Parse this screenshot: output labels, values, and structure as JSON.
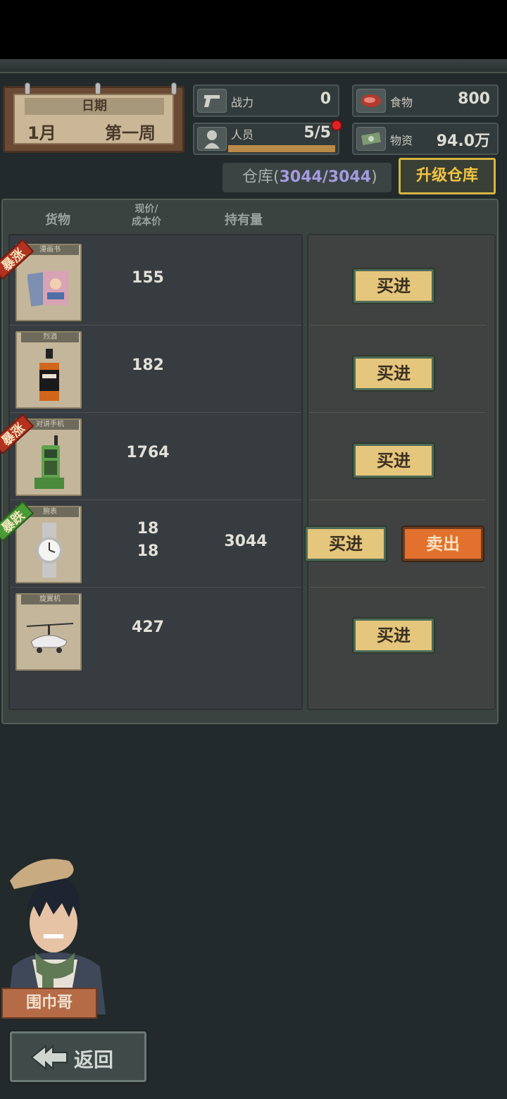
{
  "date": {
    "title": "日期",
    "month": "1月",
    "week": "第一周"
  },
  "stats": {
    "power": {
      "label": "战力",
      "value": "0",
      "icon": "pistol-icon"
    },
    "food": {
      "label": "食物",
      "value": "800",
      "icon": "steak-icon"
    },
    "staff": {
      "label": "人员",
      "value": "5/5",
      "icon": "person-icon",
      "progress": 1.0
    },
    "supplies": {
      "label": "物资",
      "value": "94.0万",
      "icon": "cash-icon"
    }
  },
  "warehouse": {
    "label": "仓库",
    "capacity": "3044/3044",
    "upgrade_label": "升级仓库"
  },
  "columns": {
    "goods": "货物",
    "price_line1": "现价/",
    "price_line2": "成本价",
    "holding": "持有量"
  },
  "items": [
    {
      "tag": "漫画书",
      "badge": "暴涨",
      "badge_type": "up",
      "price": "155",
      "cost": "",
      "holding": "",
      "buy": "买进",
      "sell": "",
      "icon": "comic-book-icon"
    },
    {
      "tag": "烈酒",
      "badge": "",
      "badge_type": "",
      "price": "182",
      "cost": "",
      "holding": "",
      "buy": "买进",
      "sell": "",
      "icon": "whiskey-bottle-icon"
    },
    {
      "tag": "对讲手机",
      "badge": "暴涨",
      "badge_type": "up",
      "price": "1764",
      "cost": "",
      "holding": "",
      "buy": "买进",
      "sell": "",
      "icon": "walkie-talkie-icon"
    },
    {
      "tag": "腕表",
      "badge": "暴跌",
      "badge_type": "down",
      "price": "18",
      "cost": "18",
      "holding": "3044",
      "buy": "买进",
      "sell": "卖出",
      "icon": "wristwatch-icon"
    },
    {
      "tag": "旋翼机",
      "badge": "",
      "badge_type": "",
      "price": "427",
      "cost": "",
      "holding": "",
      "buy": "买进",
      "sell": "",
      "icon": "gyrocopter-icon"
    }
  ],
  "character": {
    "name": "围巾哥"
  },
  "back_label": "返回",
  "colors": {
    "accent_gold": "#f1c543",
    "buy": "#e4c67c",
    "sell": "#e2712d",
    "warehouse_count": "#a59be0"
  }
}
